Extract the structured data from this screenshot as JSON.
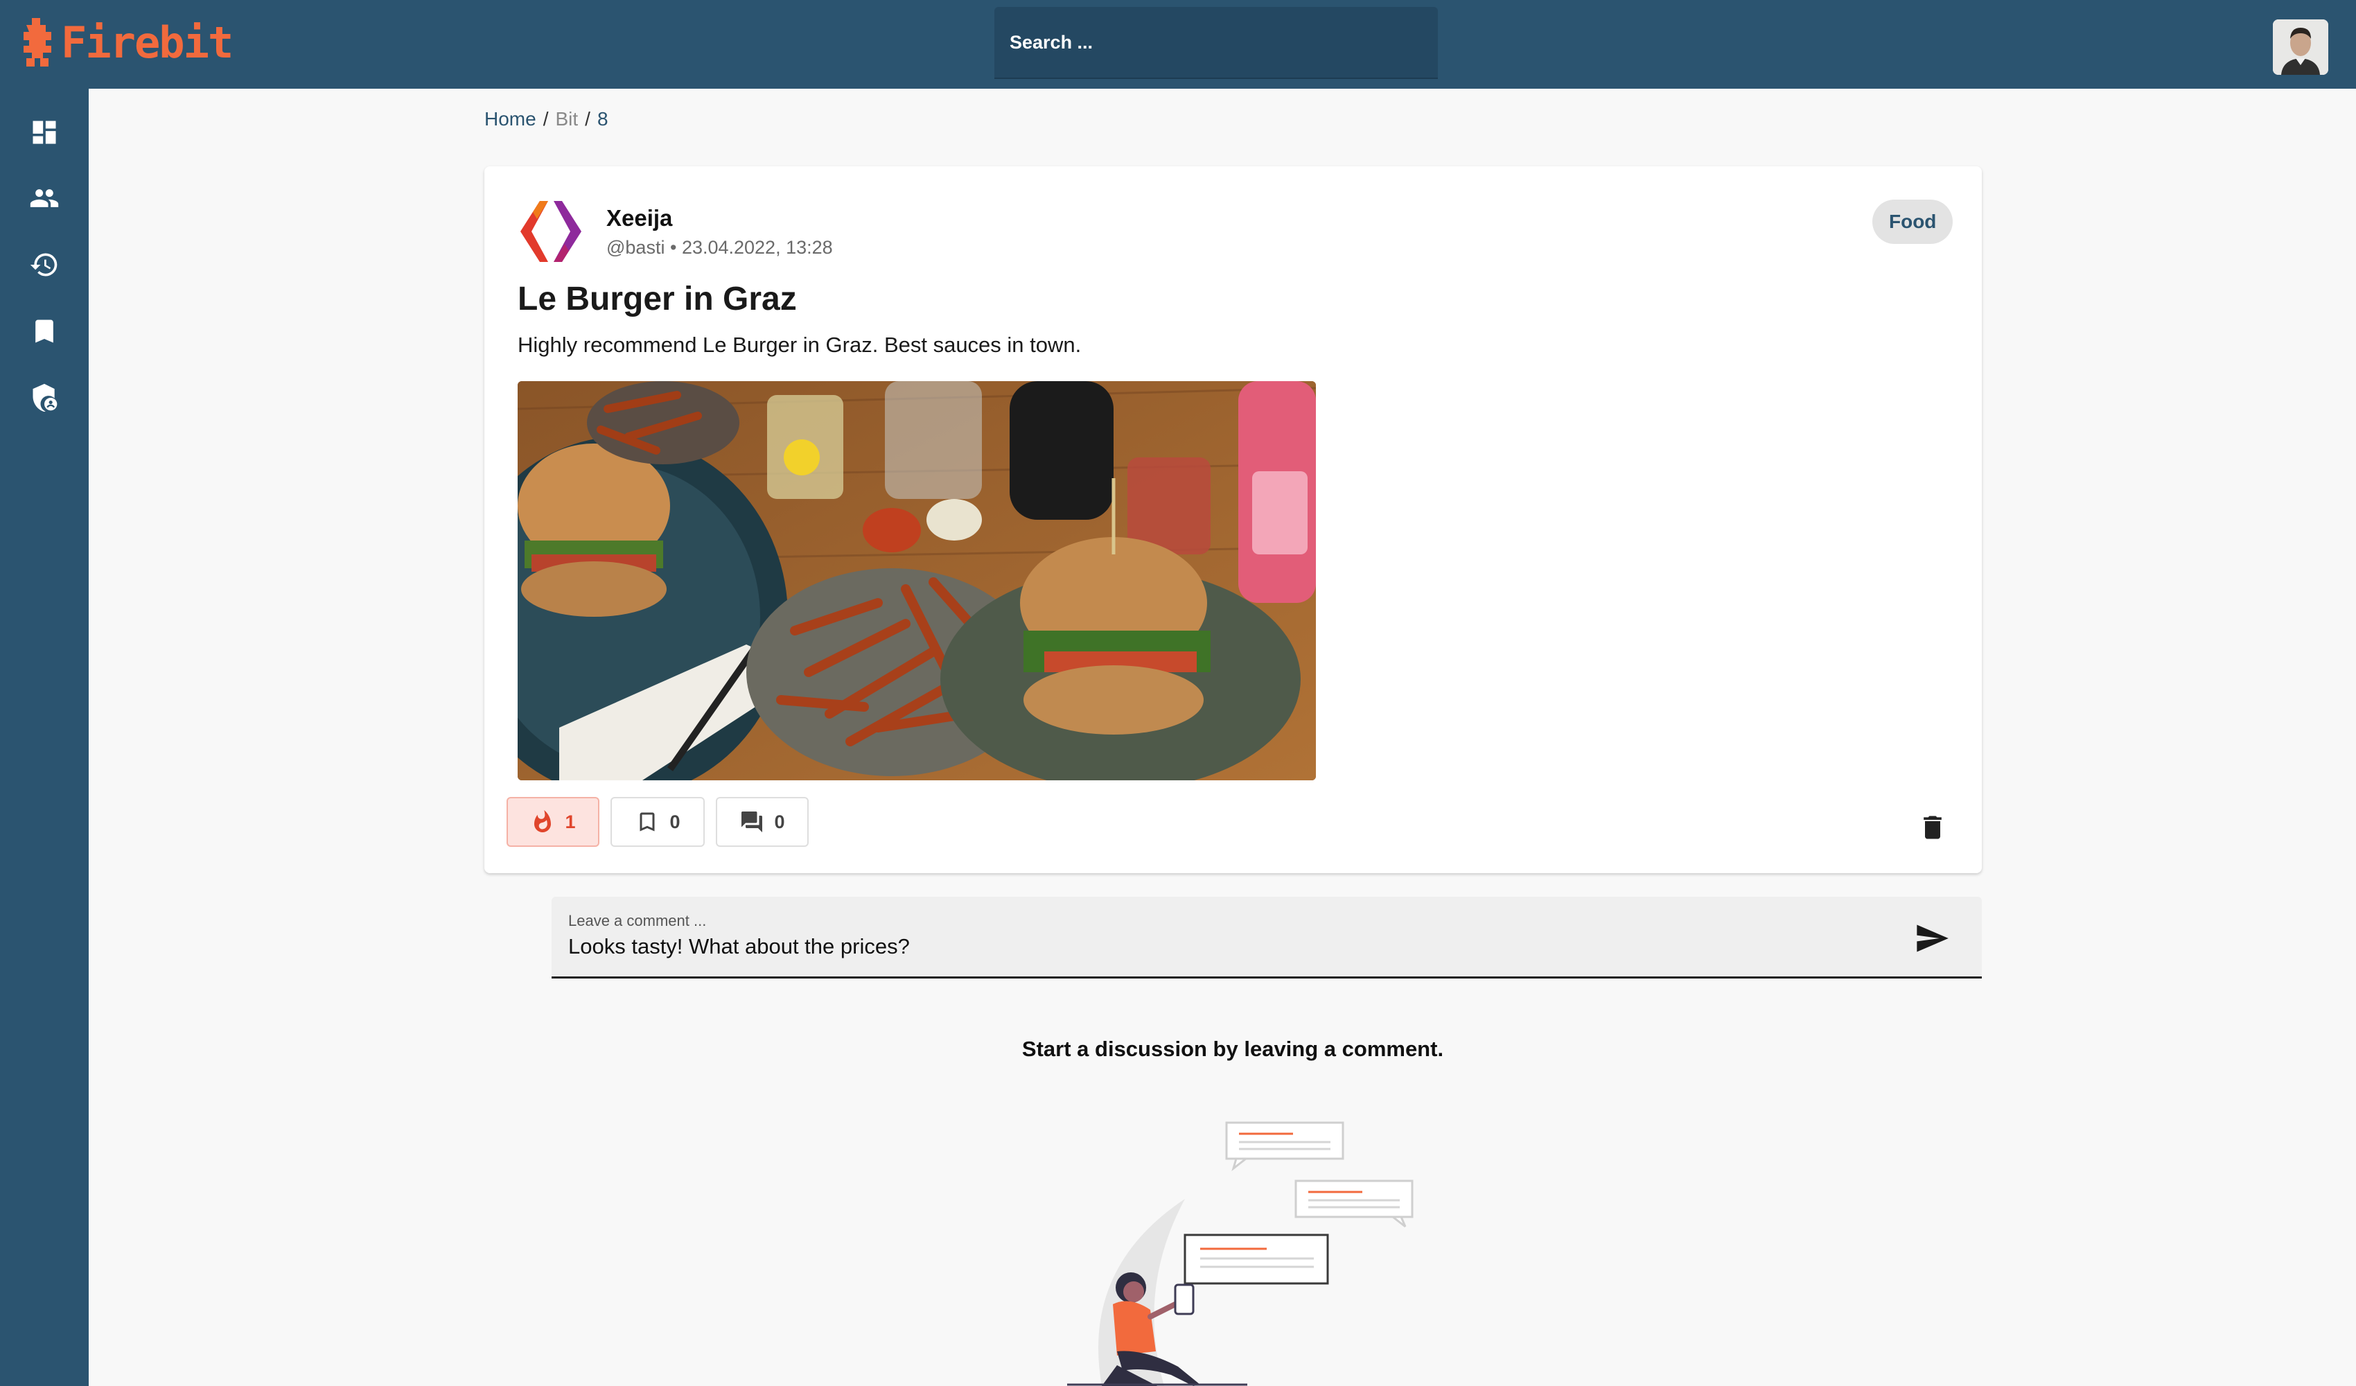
{
  "app": {
    "name": "Firebit",
    "brand_color": "#f26a3d",
    "primary_color": "#2b5470"
  },
  "header": {
    "search_placeholder": "Search ..."
  },
  "sidebar": {
    "items": [
      {
        "icon": "dashboard-icon"
      },
      {
        "icon": "people-icon"
      },
      {
        "icon": "history-icon"
      },
      {
        "icon": "bookmark-icon"
      },
      {
        "icon": "admin-shield-icon"
      }
    ]
  },
  "breadcrumb": {
    "items": [
      "Home",
      "Bit",
      "8"
    ],
    "separator": "/"
  },
  "post": {
    "author_name": "Xeeija",
    "author_handle": "@basti",
    "meta_separator": "•",
    "timestamp": "23.04.2022, 13:28",
    "category": "Food",
    "title": "Le Burger in Graz",
    "body": "Highly recommend Le Burger in Graz. Best sauces in town.",
    "fire_count": "1",
    "bookmark_count": "0",
    "comment_count": "0"
  },
  "comment_field": {
    "label": "Leave a comment ...",
    "value": "Looks tasty! What about the prices?"
  },
  "empty_state": {
    "text": "Start a discussion by leaving a comment."
  }
}
